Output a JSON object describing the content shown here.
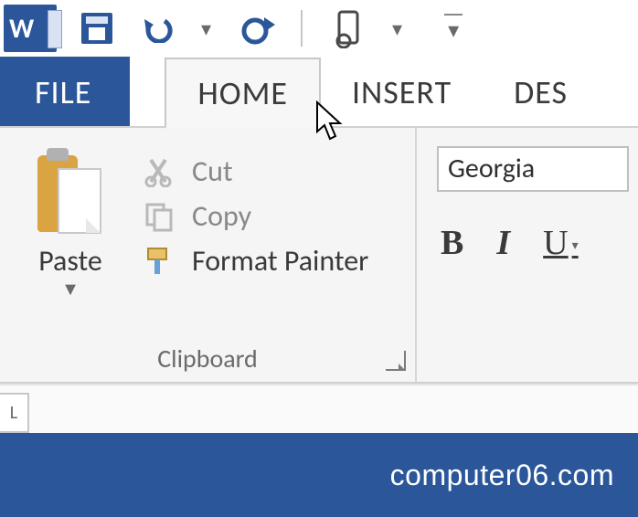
{
  "qat": {
    "app_letter": "W"
  },
  "tabs": {
    "file": "FILE",
    "home": "HOME",
    "insert": "INSERT",
    "design_partial": "DES"
  },
  "clipboard": {
    "paste": "Paste",
    "cut": "Cut",
    "copy": "Copy",
    "format_painter": "Format Painter",
    "group_label": "Clipboard"
  },
  "font": {
    "current": "Georgia",
    "bold": "B",
    "italic": "I",
    "underline": "U"
  },
  "page_tab": "L",
  "watermark": "computer06.com"
}
